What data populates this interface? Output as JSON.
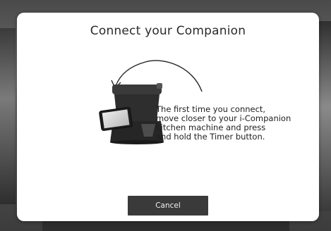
{
  "dialog": {
    "title": "Connect your Companion",
    "instruction_lines": [
      "The first time you connect,",
      "move closer to your i-Companion",
      "kitchen machine and press",
      "and hold the Timer button."
    ],
    "cancel_label": "Cancel"
  },
  "illustration": {
    "device_icon": "kitchen-machine-with-phone-icon",
    "arrow_icon": "curved-arrow-icon"
  },
  "colors": {
    "modal_background": "#ffffff",
    "title_text": "#2b2b2b",
    "button_background": "#3a3a3a",
    "button_text": "#f0f0f0",
    "backdrop": "#5a5a5a"
  }
}
